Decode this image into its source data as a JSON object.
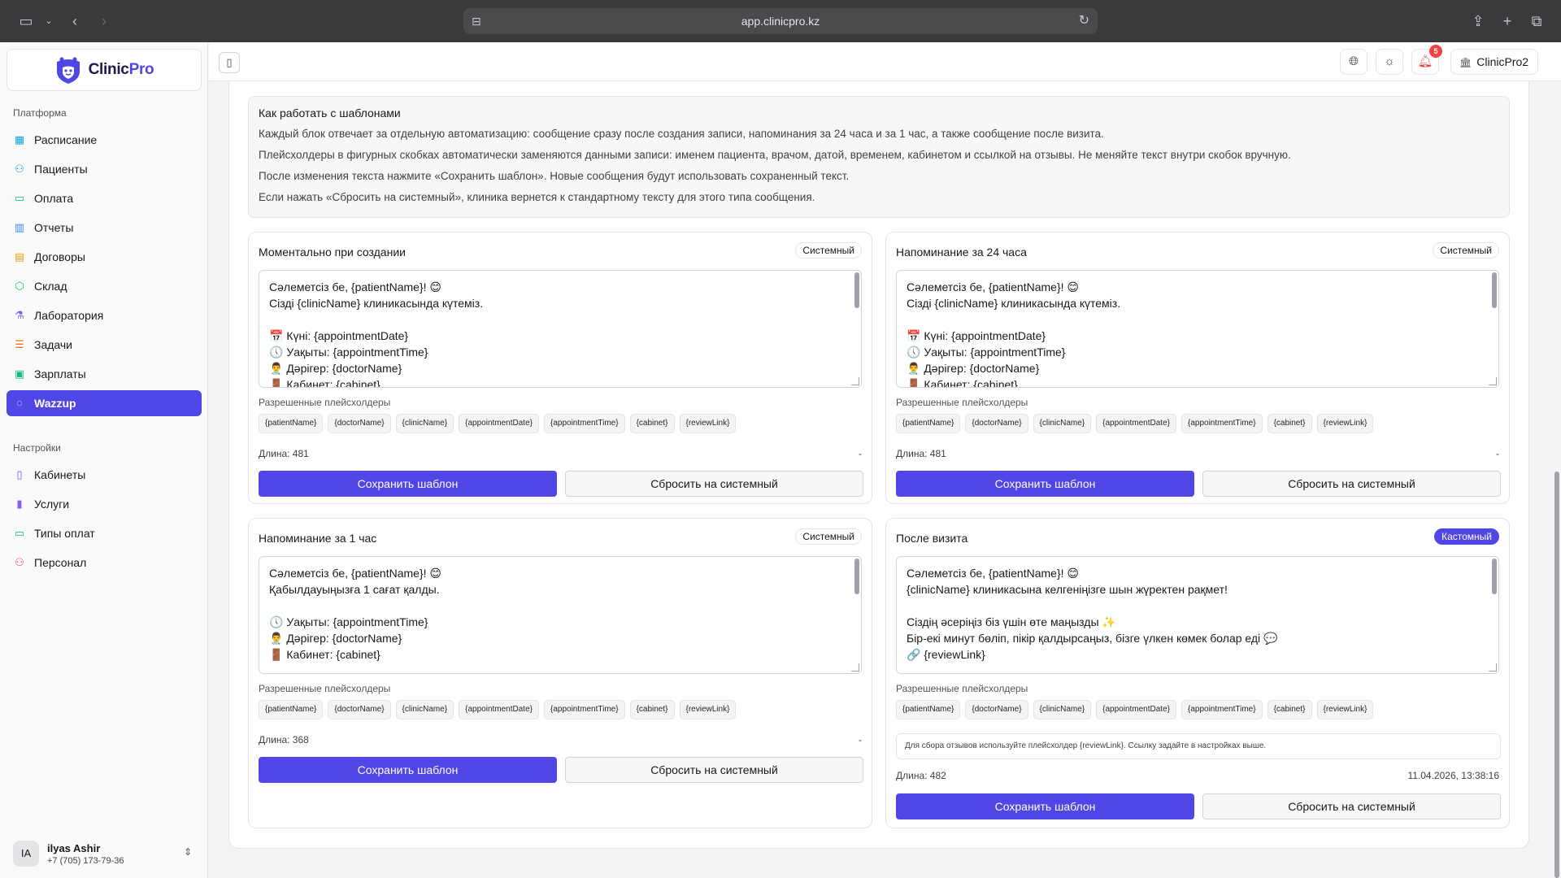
{
  "browser": {
    "url": "app.clinicpro.kz"
  },
  "brand": {
    "name_part1": "Clinic",
    "name_part2": "Pro",
    "accent": "#4f46e5"
  },
  "sidebar": {
    "platform_title": "Платформа",
    "platform_items": [
      {
        "label": "Расписание",
        "icon": "calendar-icon",
        "color": "#0ea5e9"
      },
      {
        "label": "Пациенты",
        "icon": "users-icon",
        "color": "#0ea5e9"
      },
      {
        "label": "Оплата",
        "icon": "credit-card-icon",
        "color": "#10b981"
      },
      {
        "label": "Отчеты",
        "icon": "bar-chart-icon",
        "color": "#3b82f6"
      },
      {
        "label": "Договоры",
        "icon": "document-icon",
        "color": "#f59e0b"
      },
      {
        "label": "Склад",
        "icon": "box-icon",
        "color": "#22c55e"
      },
      {
        "label": "Лаборатория",
        "icon": "flask-icon",
        "color": "#6366f1"
      },
      {
        "label": "Задачи",
        "icon": "tasks-icon",
        "color": "#f97316"
      },
      {
        "label": "Зарплаты",
        "icon": "money-icon",
        "color": "#10b981"
      },
      {
        "label": "Wazzup",
        "icon": "whatsapp-icon",
        "color": "#ffffff"
      }
    ],
    "settings_title": "Настройки",
    "settings_items": [
      {
        "label": "Кабинеты",
        "icon": "map-icon",
        "color": "#6366f1"
      },
      {
        "label": "Услуги",
        "icon": "book-icon",
        "color": "#8b5cf6"
      },
      {
        "label": "Типы оплат",
        "icon": "wallet-icon",
        "color": "#10b981"
      },
      {
        "label": "Персонал",
        "icon": "staff-icon",
        "color": "#f43f5e"
      }
    ],
    "user": {
      "initials": "IA",
      "name": "ilyas Ashir",
      "phone": "+7 (705) 173-79-36"
    }
  },
  "topbar": {
    "notifications_count": "5",
    "clinic_name": "ClinicPro2"
  },
  "info": {
    "title": "Как работать с шаблонами",
    "lines": [
      "Каждый блок отвечает за отдельную автоматизацию: сообщение сразу после создания записи, напоминания за 24 часа и за 1 час, а также сообщение после визита.",
      "Плейсхолдеры в фигурных скобках автоматически заменяются данными записи: именем пациента, врачом, датой, временем, кабинетом и ссылкой на отзывы. Не меняйте текст внутри скобок вручную.",
      "После изменения текста нажмите «Сохранить шаблон». Новые сообщения будут использовать сохраненный текст.",
      "Если нажать «Сбросить на системный», клиника вернется к стандартному тексту для этого типа сообщения."
    ]
  },
  "common": {
    "placeholders_label": "Разрешенные плейсхолдеры",
    "placeholders": [
      "{patientName}",
      "{doctorName}",
      "{clinicName}",
      "{appointmentDate}",
      "{appointmentTime}",
      "{cabinet}",
      "{reviewLink}"
    ],
    "save_label": "Сохранить шаблон",
    "reset_label": "Сбросить на системный"
  },
  "templates": [
    {
      "title": "Моментально при создании",
      "status": "Системный",
      "text": "Сәлеметсіз бе, {patientName}! 😊\nСізді {clinicName} клиникасында күтеміз.\n\n📅 Күні: {appointmentDate}\n🕔 Уақыты: {appointmentTime}\n👨‍⚕️ Дәрігер: {doctorName}\n🚪 Кабинет: {cabinet}",
      "length": "Длина: 481",
      "updated": "-"
    },
    {
      "title": "Напоминание за 24 часа",
      "status": "Системный",
      "text": "Сәлеметсіз бе, {patientName}! 😊\nСізді {clinicName} клиникасында күтеміз.\n\n📅 Күні: {appointmentDate}\n🕔 Уақыты: {appointmentTime}\n👨‍⚕️ Дәрігер: {doctorName}\n🚪 Кабинет: {cabinet}",
      "length": "Длина: 481",
      "updated": "-"
    },
    {
      "title": "Напоминание за 1 час",
      "status": "Системный",
      "text": "Сәлеметсіз бе, {patientName}! 😊\nҚабылдауыңызға 1 сағат қалды.\n\n🕔 Уақыты: {appointmentTime}\n👨‍⚕️ Дәрігер: {doctorName}\n🚪 Кабинет: {cabinet}",
      "length": "Длина: 368",
      "updated": "-"
    },
    {
      "title": "После визита",
      "status": "Кастомный",
      "text": "Сәлеметсіз бе, {patientName}! 😊\n{clinicName} клиникасына келгеніңізге шын жүректен рақмет!\n\nСіздің әсеріңіз біз үшін өте маңызды ✨\nБір-екі минут бөліп, пікір қалдырсаңыз, бізге үлкен көмек болар еді 💬\n🔗 {reviewLink}",
      "note": "Для сбора отзывов используйте плейсхолдер {reviewLink}. Ссылку задайте в настройках выше.",
      "length": "Длина: 482",
      "updated": "11.04.2026, 13:38:16"
    }
  ]
}
